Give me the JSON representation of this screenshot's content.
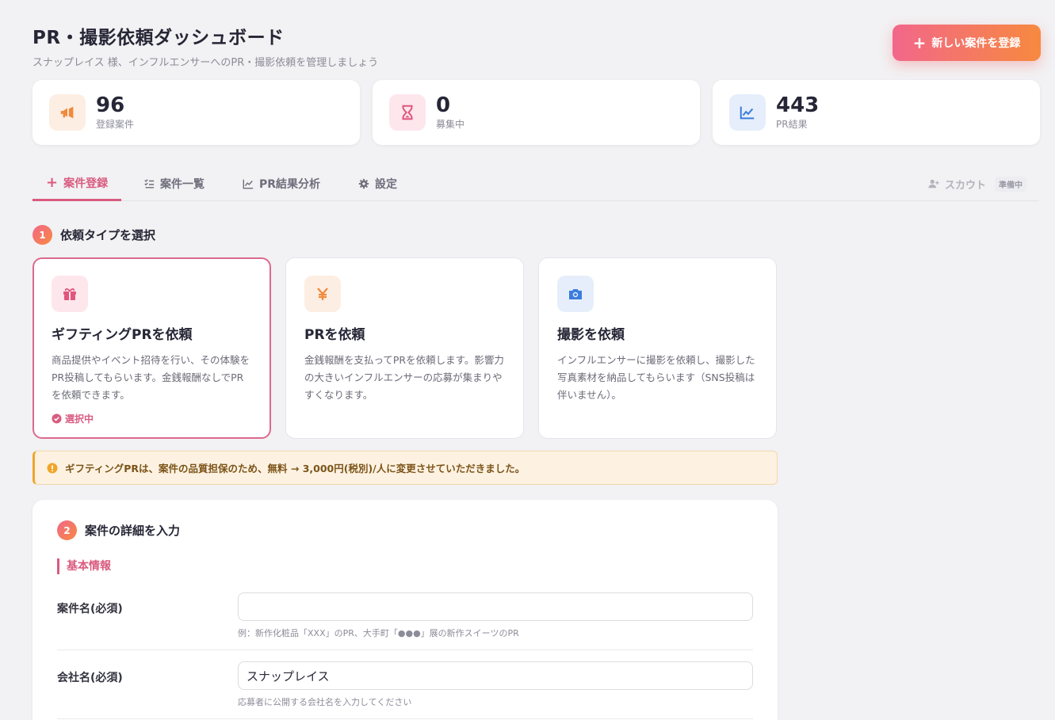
{
  "header": {
    "title": "PR・撮影依頼ダッシュボード",
    "subtitle": "スナップレイス 様、インフルエンサーへのPR・撮影依頼を管理しましょう",
    "new_button": "新しい案件を登録"
  },
  "stats": [
    {
      "value": "96",
      "label": "登録案件",
      "icon": "megaphone-icon",
      "color": "#f08a3c"
    },
    {
      "value": "0",
      "label": "募集中",
      "icon": "hourglass-icon",
      "color": "#e0567c"
    },
    {
      "value": "443",
      "label": "PR結果",
      "icon": "chart-line-icon",
      "color": "#3b7ddd"
    }
  ],
  "tabs": {
    "register": "案件登録",
    "list": "案件一覧",
    "analysis": "PR結果分析",
    "settings": "設定",
    "scout": "スカウト",
    "scout_badge": "準備中"
  },
  "step1": {
    "number": "1",
    "title": "依頼タイプを選択",
    "types": [
      {
        "title": "ギフティングPRを依頼",
        "desc": "商品提供やイベント招待を行い、その体験をPR投稿してもらいます。金銭報酬なしでPRを依頼できます。",
        "icon": "gift-icon",
        "selected": true
      },
      {
        "title": "PRを依頼",
        "desc": "金銭報酬を支払ってPRを依頼します。影響力の大きいインフルエンサーの応募が集まりやすくなります。",
        "icon": "yen-icon",
        "selected": false
      },
      {
        "title": "撮影を依頼",
        "desc": "インフルエンサーに撮影を依頼し、撮影した写真素材を納品してもらいます（SNS投稿は伴いません）。",
        "icon": "camera-icon",
        "selected": false
      }
    ],
    "selected_label": "選択中"
  },
  "notice": "ギフティングPRは、案件の品質担保のため、無料 → 3,000円(税別)/人に変更させていただきました。",
  "step2": {
    "number": "2",
    "title": "案件の詳細を入力",
    "subsection": "基本情報",
    "fields": [
      {
        "label": "案件名(必須)",
        "value": "",
        "hint": "例：新作化粧品「XXX」のPR、大手町「●●●」展の新作スイーツのPR"
      },
      {
        "label": "会社名(必須)",
        "value": "スナップレイス",
        "hint": "応募者に公開する会社名を入力してください"
      }
    ]
  }
}
